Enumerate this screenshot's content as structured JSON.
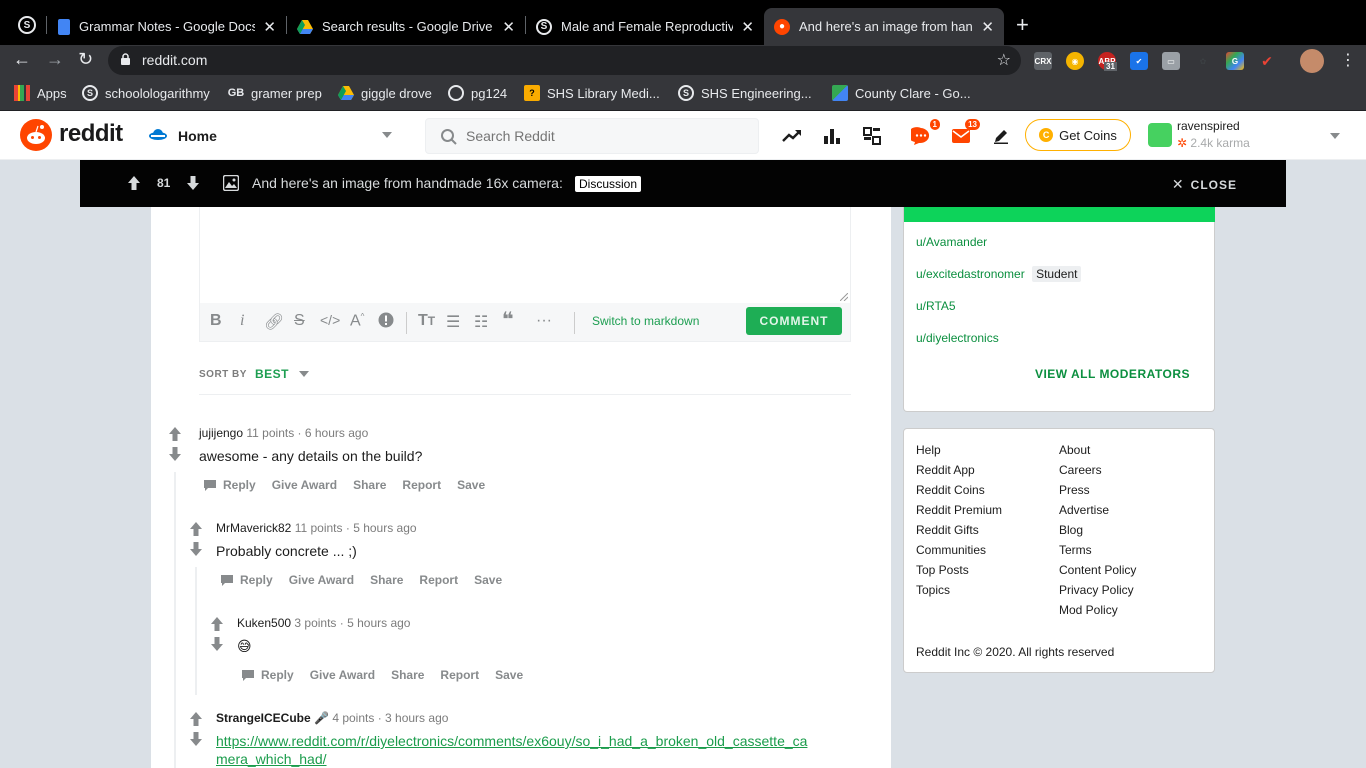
{
  "browser": {
    "tabs": [
      {
        "title": "Grammar Notes - Google Docs",
        "favicon": "google-docs-icon"
      },
      {
        "title": "Search results - Google Drive",
        "favicon": "google-drive-icon"
      },
      {
        "title": "Male and Female Reproductive",
        "favicon": "schoology-icon"
      },
      {
        "title": "And here's an image from hand",
        "favicon": "reddit-icon"
      }
    ],
    "url": "reddit.com",
    "bookmarks": [
      {
        "label": "Apps"
      },
      {
        "label": "schoolologarithmy"
      },
      {
        "label": "gramer prep"
      },
      {
        "label": "giggle drove"
      },
      {
        "label": "pg124"
      },
      {
        "label": "SHS Library Medi..."
      },
      {
        "label": "SHS Engineering..."
      },
      {
        "label": "County Clare - Go..."
      }
    ],
    "extension_badge": "31"
  },
  "header": {
    "brand": "reddit",
    "feed_label": "Home",
    "search_placeholder": "Search Reddit",
    "chat_badge": "1",
    "mail_badge": "13",
    "coins_label": "Get Coins",
    "username": "ravenspired",
    "karma": "2.4k karma"
  },
  "post_bar": {
    "score": "81",
    "title": "And here's an image from handmade 16x camera:",
    "flair": "Discussion",
    "close_label": "CLOSE"
  },
  "editor": {
    "switch_label": "Switch to markdown",
    "comment_label": "COMMENT"
  },
  "sort": {
    "label": "SORT BY",
    "value": "BEST"
  },
  "comments": [
    {
      "author": "jujijengo",
      "points": "11 points",
      "time": "6 hours ago",
      "body": "awesome - any details on the build?"
    },
    {
      "author": "MrMaverick82",
      "points": "11 points",
      "time": "5 hours ago",
      "body": "Probably concrete ... ;)"
    },
    {
      "author": "Kuken500",
      "points": "3 points",
      "time": "5 hours ago",
      "body": "😅"
    },
    {
      "author": "StrangeICECube",
      "author_emoji": "🎤",
      "points": "4 points",
      "time": "3 hours ago",
      "link_line1": "https://www.reddit.com/r/diyelectronics/comments/ex6ouy/so_i_had_a_broken_old_cassette_ca",
      "link_line2": "mera_which_had/"
    }
  ],
  "comment_actions": {
    "reply": "Reply",
    "award": "Give Award",
    "share": "Share",
    "report": "Report",
    "save": "Save"
  },
  "sidebar": {
    "moderators": [
      {
        "name": "u/Avamander"
      },
      {
        "name": "u/excitedastronomer",
        "flair": "Student"
      },
      {
        "name": "u/RTA5"
      },
      {
        "name": "u/diyelectronics"
      }
    ],
    "view_all": "VIEW ALL MODERATORS",
    "footer_left": [
      "Help",
      "Reddit App",
      "Reddit Coins",
      "Reddit Premium",
      "Reddit Gifts",
      "Communities",
      "Top Posts",
      "Topics"
    ],
    "footer_right": [
      "About",
      "Careers",
      "Press",
      "Advertise",
      "Blog",
      "Terms",
      "Content Policy",
      "Privacy Policy",
      "Mod Policy"
    ],
    "copyright": "Reddit Inc © 2020. All rights reserved"
  },
  "colors": {
    "accent_green": "#1eae55",
    "reddit_orange": "#ff4500",
    "header_black": "#030303"
  }
}
